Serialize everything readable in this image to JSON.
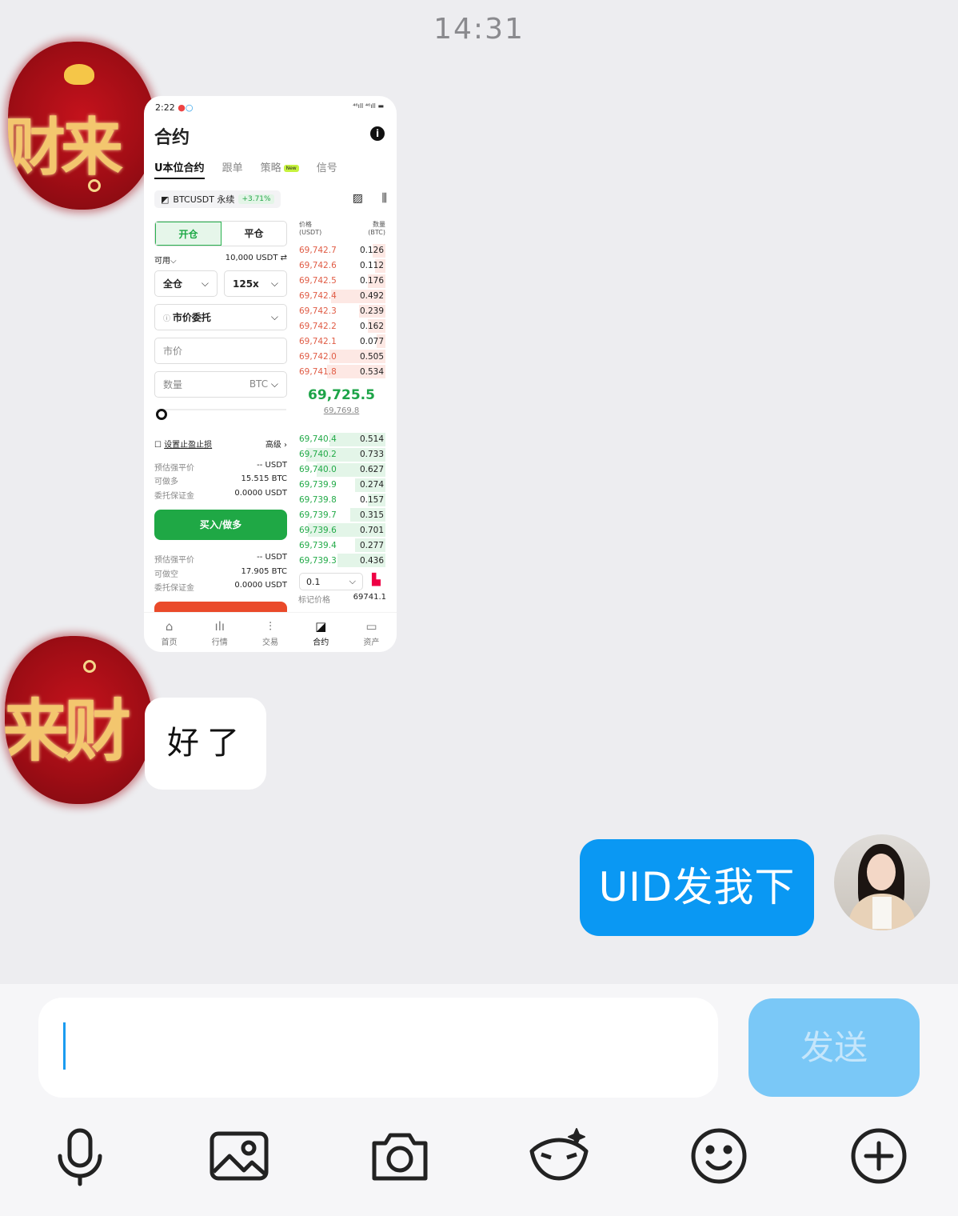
{
  "status_time": "14:31",
  "contact_avatar_text_1": "财来",
  "contact_avatar_text_2": "来财",
  "shot": {
    "status_time": "2:22",
    "status_right": "⁴⁶ıll ⁴⁶ıll ▬",
    "title": "合约",
    "tabs": [
      "U本位合约",
      "跟单",
      "策略",
      "信号"
    ],
    "new_badge": "New",
    "pair": "BTCUSDT 永续",
    "change": "+3.71%",
    "open_label": "开仓",
    "close_label": "平仓",
    "avail_label": "可用",
    "avail_value": "10,000 USDT",
    "margin_mode": "全仓",
    "leverage": "125x",
    "order_type": "市价委托",
    "price_placeholder": "市价",
    "qty_placeholder": "数量",
    "qty_unit": "BTC",
    "tpsl_label": "设置止盈止损",
    "advanced_label": "高级",
    "long_stats": [
      {
        "k": "预估强平价",
        "v": "-- USDT"
      },
      {
        "k": "可做多",
        "v": "15.515 BTC"
      },
      {
        "k": "委托保证金",
        "v": "0.0000 USDT"
      }
    ],
    "buy_label": "买入/做多",
    "short_stats": [
      {
        "k": "预估强平价",
        "v": "-- USDT"
      },
      {
        "k": "可做空",
        "v": "17.905 BTC"
      },
      {
        "k": "委托保证金",
        "v": "0.0000 USDT"
      }
    ],
    "ob_header_left": "价格\n(USDT)",
    "ob_header_right": "数量\n(BTC)",
    "asks": [
      {
        "p": "69,742.7",
        "q": "0.126",
        "depth": 0.15
      },
      {
        "p": "69,742.6",
        "q": "0.112",
        "depth": 0.12
      },
      {
        "p": "69,742.5",
        "q": "0.176",
        "depth": 0.2
      },
      {
        "p": "69,742.4",
        "q": "0.492",
        "depth": 0.62
      },
      {
        "p": "69,742.3",
        "q": "0.239",
        "depth": 0.3
      },
      {
        "p": "69,742.2",
        "q": "0.162",
        "depth": 0.2
      },
      {
        "p": "69,742.1",
        "q": "0.077",
        "depth": 0.1
      },
      {
        "p": "69,742.0",
        "q": "0.505",
        "depth": 0.64
      },
      {
        "p": "69,741.8",
        "q": "0.534",
        "depth": 0.66
      }
    ],
    "last_price": "69,725.5",
    "mark_under": "69,769.8",
    "bids": [
      {
        "p": "69,740.4",
        "q": "0.514",
        "depth": 0.64
      },
      {
        "p": "69,740.2",
        "q": "0.733",
        "depth": 0.9
      },
      {
        "p": "69,740.0",
        "q": "0.627",
        "depth": 0.78
      },
      {
        "p": "69,739.9",
        "q": "0.274",
        "depth": 0.35
      },
      {
        "p": "69,739.8",
        "q": "0.157",
        "depth": 0.2
      },
      {
        "p": "69,739.7",
        "q": "0.315",
        "depth": 0.4
      },
      {
        "p": "69,739.6",
        "q": "0.701",
        "depth": 0.88
      },
      {
        "p": "69,739.4",
        "q": "0.277",
        "depth": 0.35
      },
      {
        "p": "69,739.3",
        "q": "0.436",
        "depth": 0.55
      }
    ],
    "depth_value": "0.1",
    "mark_price_label": "标记价格",
    "mark_price_value": "69741.1",
    "nav": [
      "首页",
      "行情",
      "交易",
      "合约",
      "资产"
    ]
  },
  "msg_received": "好了",
  "msg_sent": "UID发我下",
  "input_value": "",
  "send_label": "发送",
  "colors": {
    "sent_bubble": "#0a98f3",
    "buy_green": "#1fa845",
    "ask_red": "#e05c45",
    "send_disabled": "#7ac8f7"
  },
  "toolbar_icons": [
    "microphone-icon",
    "image-icon",
    "camera-icon",
    "face-mask-icon",
    "emoji-icon",
    "plus-circle-icon"
  ]
}
